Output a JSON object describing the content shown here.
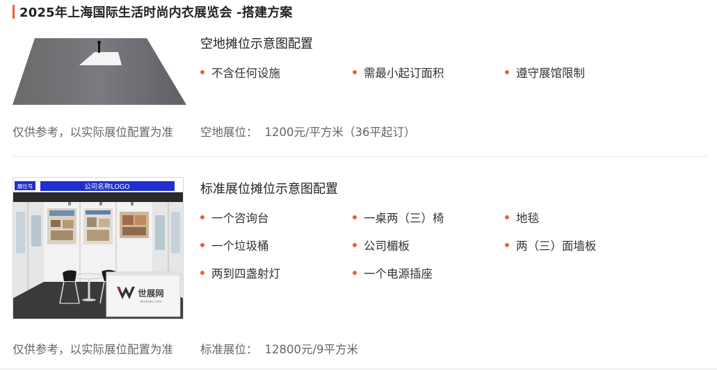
{
  "header": {
    "title": "2025年上海国际生活时尚内衣展览会 -搭建方案",
    "accent_color": "#e8632b"
  },
  "booths": [
    {
      "title": "空地摊位示意图配置",
      "features": [
        "不含任何设施",
        "需最小起订面积",
        "遵守展馆限制"
      ],
      "note": "仅供参考，以实际展位配置为准",
      "price_label": "空地展位：",
      "price_value": "1200元/平方米（36平起订）",
      "image": "raw-space-floor-illustration"
    },
    {
      "title": "标准展位摊位示意图配置",
      "features": [
        "一个咨询台",
        "一桌两（三）椅",
        "地毯",
        "一个垃圾桶",
        "公司楣板",
        "两（三）面墙板",
        "两到四盏射灯",
        "一个电源插座"
      ],
      "note": "仅供参考，以实际展位配置为准",
      "price_label": "标准展位：",
      "price_value": "12800元/9平方米",
      "image": "standard-booth-photo",
      "image_texts": {
        "booth_number": "展位号",
        "fascia": "公司名称LOGO",
        "desk_logo": "世展网",
        "desk_logo_sub": "shizhan.com"
      }
    }
  ]
}
